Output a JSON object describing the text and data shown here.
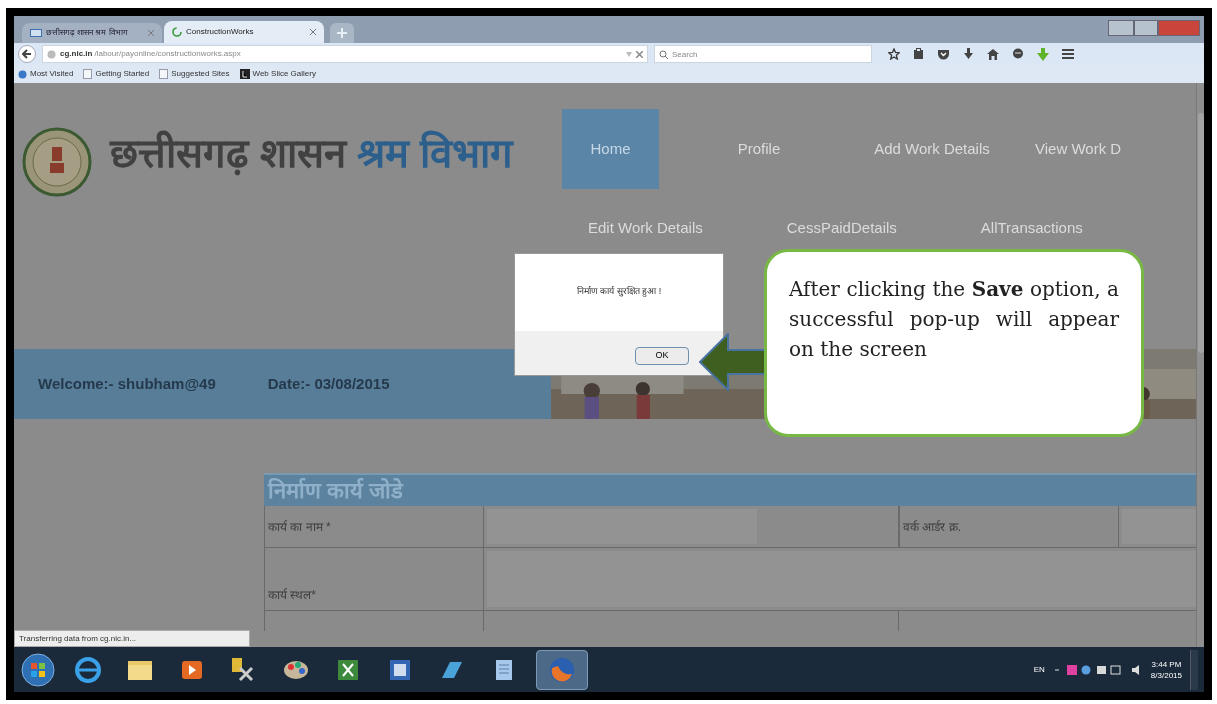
{
  "browser": {
    "tabs": [
      {
        "label": "छत्तीसगढ़ शासन श्रम विभाग",
        "selected": false
      },
      {
        "label": "ConstructionWorks",
        "selected": true
      }
    ],
    "url": {
      "domain": "cg.nic.in",
      "path": "/labour/payonline/constructionworks.aspx"
    },
    "search": {
      "placeholder": "Search"
    },
    "bookmarks": [
      "Most Visited",
      "Getting Started",
      "Suggested Sites",
      "Web Slice Gallery"
    ]
  },
  "page": {
    "title": "छत्तीसगढ़ शासन",
    "title_accent": "श्रम विभाग",
    "nav_rows": [
      [
        {
          "label": "Home",
          "selected": true
        },
        {
          "label": "Profile",
          "selected": false
        },
        {
          "label": "Add Work Details",
          "selected": false
        },
        {
          "label": "View Work D",
          "selected": false
        }
      ],
      [
        {
          "label": "Edit Work Details",
          "selected": false
        },
        {
          "label": "CessPaidDetails",
          "selected": false
        },
        {
          "label": "AllTransactions",
          "selected": false
        }
      ]
    ],
    "welcome": "Welcome:- shubham@49",
    "date": "Date:- 03/08/2015",
    "form": {
      "title": "निर्माण कार्य जोडे",
      "rows": [
        [
          {
            "label": "कार्य का नाम *"
          },
          {
            "label": "वर्क आर्डर क्र."
          }
        ],
        [
          {
            "label": "कार्य स्थल*"
          }
        ]
      ]
    }
  },
  "dialog": {
    "message": "निर्माण कार्य सुरक्षित हुआ !",
    "button": "OK"
  },
  "callout": "After clicking the **Save** option, a successful pop-up will appear on the screen",
  "status": "Transferring data from cg.nic.in...",
  "taskbar": {
    "language": "EN",
    "time": "3:44 PM",
    "date": "8/3/2015"
  }
}
